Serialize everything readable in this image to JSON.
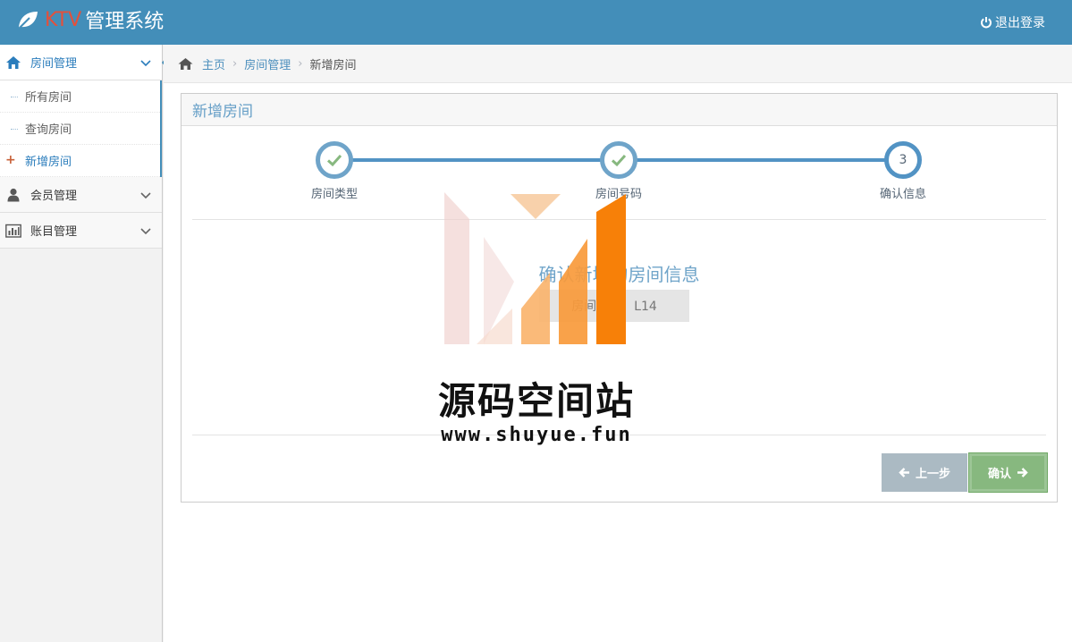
{
  "navbar": {
    "brand_accent": "KTV",
    "brand_title": "管理系统",
    "logout_label": "退出登录"
  },
  "sidebar": {
    "groups": [
      {
        "label": "房间管理",
        "icon": "home-icon",
        "expanded": true,
        "items": [
          {
            "label": "所有房间"
          },
          {
            "label": "查询房间"
          },
          {
            "label": "新增房间",
            "active": true
          }
        ]
      },
      {
        "label": "会员管理",
        "icon": "user-icon"
      },
      {
        "label": "账目管理",
        "icon": "chart-icon"
      }
    ]
  },
  "breadcrumb": {
    "home": "主页",
    "section": "房间管理",
    "current": "新增房间"
  },
  "widget": {
    "title": "新增房间",
    "steps": [
      {
        "label": "房间类型",
        "state": "done"
      },
      {
        "label": "房间号码",
        "state": "done"
      },
      {
        "label": "确认信息",
        "state": "current",
        "number": "3"
      }
    ],
    "confirm_title": "确认新增的房间信息",
    "confirm_value": "房间编号：L14",
    "prev_label": "上一步",
    "next_label": "确认"
  },
  "watermark": {
    "text": "源码空间站",
    "url": "www.shuyue.fun"
  },
  "colors": {
    "navbar": "#438eb9",
    "brand_accent": "#e4503b",
    "step": "#5293c4",
    "check": "#87b87f",
    "prev_button": "#abbac3",
    "next_button": "#87b87f"
  }
}
